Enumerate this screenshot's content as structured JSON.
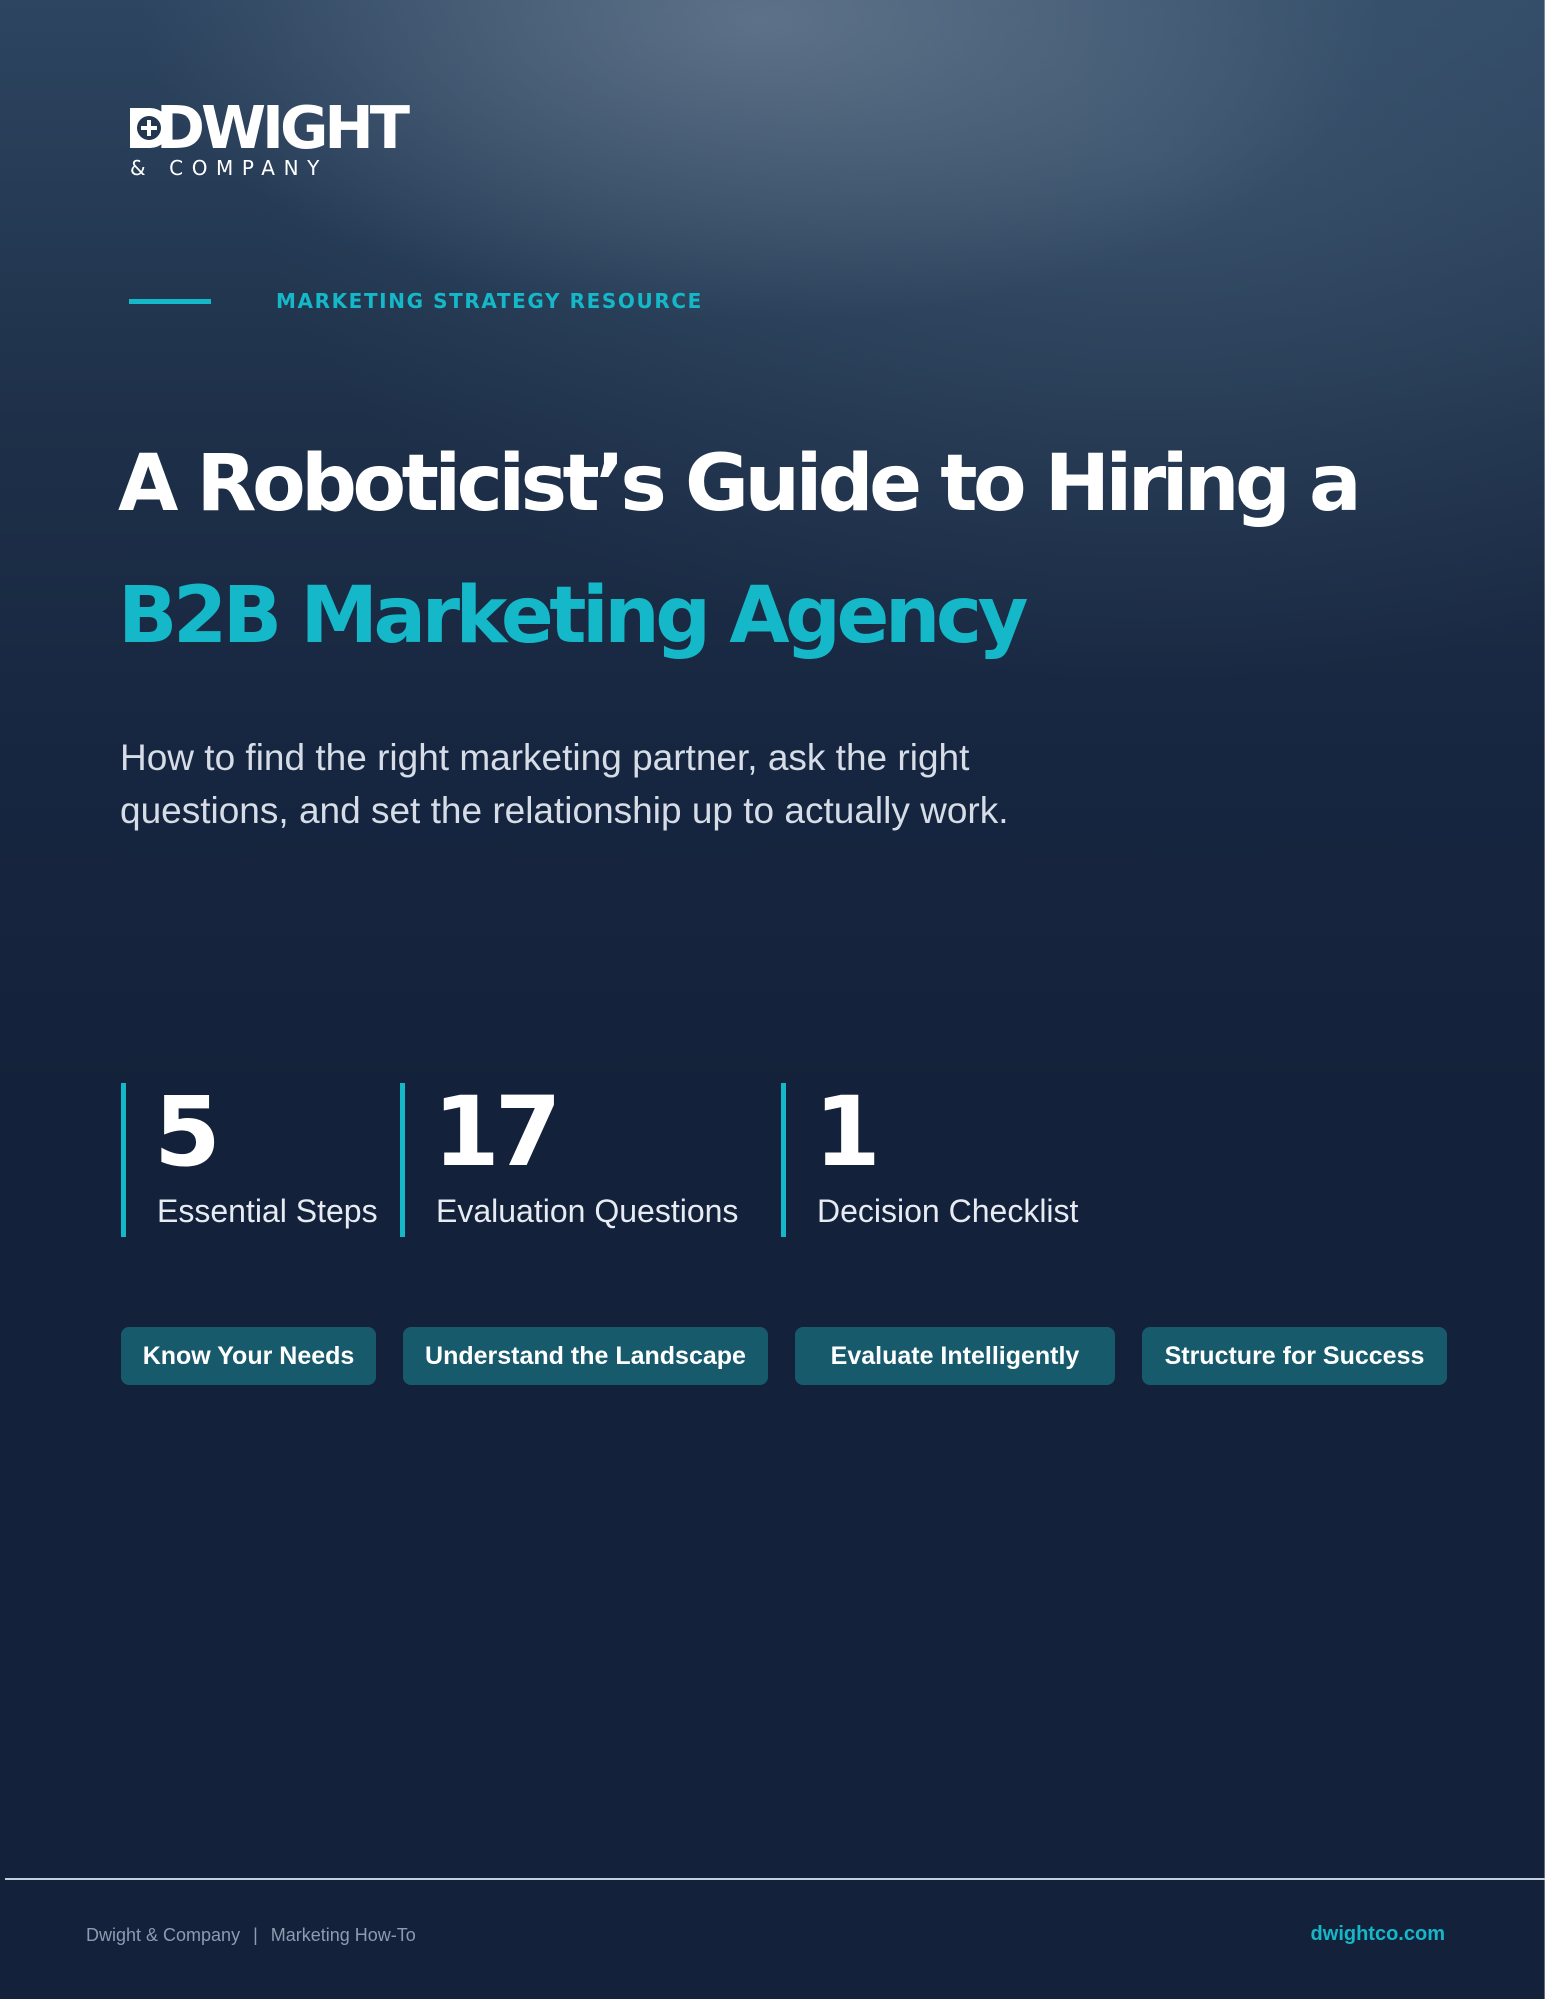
{
  "brand": {
    "name": "DWIGHT",
    "sub": "& COMPANY"
  },
  "eyebrow": "MARKETING STRATEGY RESOURCE",
  "title": {
    "line1": "A Roboticist’s Guide to Hiring a",
    "line2": "B2B Marketing Agency"
  },
  "subtitle": {
    "line1": "How to find the right marketing partner, ask the right",
    "line2": "questions, and set the relationship up to actually work."
  },
  "stats": [
    {
      "number": "5",
      "label": "Essential Steps"
    },
    {
      "number": "17",
      "label": "Evaluation Questions"
    },
    {
      "number": "1",
      "label": "Decision Checklist"
    }
  ],
  "pills": [
    "Know Your Needs",
    "Understand the Landscape",
    "Evaluate Intelligently",
    "Structure for Success"
  ],
  "footer": {
    "company": "Dwight & Company",
    "separator": "|",
    "category": "Marketing How-To",
    "url": "dwightco.com"
  },
  "colors": {
    "accent": "#14b8c8",
    "background": "#14213a",
    "pill": "#165a6c"
  },
  "icons": {
    "logo_mark": "plus-in-d-icon"
  }
}
